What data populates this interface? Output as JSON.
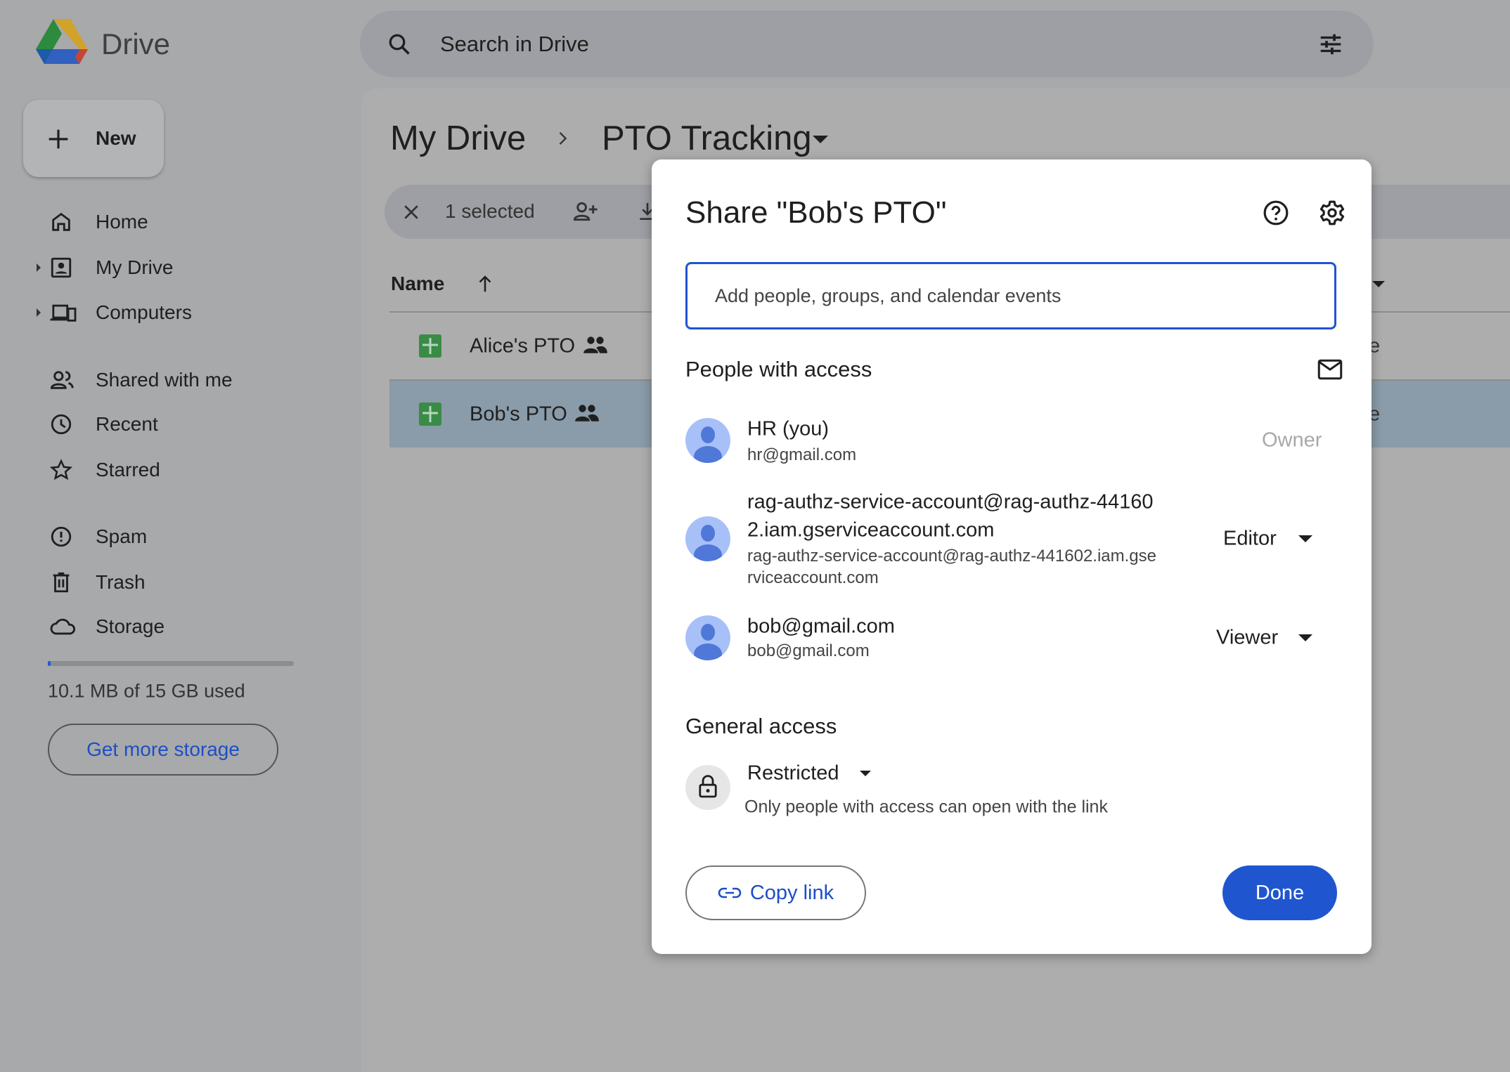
{
  "app": {
    "name": "Drive"
  },
  "search": {
    "placeholder": "Search in Drive"
  },
  "sidebar": {
    "new_label": "New",
    "items": [
      {
        "label": "Home",
        "icon": "home-icon"
      },
      {
        "label": "My Drive",
        "icon": "my-drive-icon"
      },
      {
        "label": "Computers",
        "icon": "computers-icon"
      },
      {
        "label": "Shared with me",
        "icon": "shared-icon"
      },
      {
        "label": "Recent",
        "icon": "clock-icon"
      },
      {
        "label": "Starred",
        "icon": "star-icon"
      },
      {
        "label": "Spam",
        "icon": "spam-icon"
      },
      {
        "label": "Trash",
        "icon": "trash-icon"
      },
      {
        "label": "Storage",
        "icon": "cloud-icon"
      }
    ],
    "storage_text": "10.1 MB of 15 GB used",
    "storage_fraction": 0.0007,
    "get_more_storage": "Get more storage"
  },
  "breadcrumb": {
    "root": "My Drive",
    "current": "PTO Tracking"
  },
  "selection": {
    "label": "1 selected"
  },
  "table": {
    "name_header": "Name",
    "rows": [
      {
        "name": "Alice's PTO",
        "trailing": "e",
        "selected": false
      },
      {
        "name": "Bob's PTO",
        "trailing": "e",
        "selected": true
      }
    ]
  },
  "dialog": {
    "title": "Share \"Bob's PTO\"",
    "input_placeholder": "Add people, groups, and calendar events",
    "people_heading": "People with access",
    "people": [
      {
        "name": "HR (you)",
        "email": "hr@gmail.com",
        "role": "Owner"
      },
      {
        "name_line1": "rag-authz-service-account@rag-authz-44160",
        "name_line2": "2.iam.gserviceaccount.com",
        "email_line1": "rag-authz-service-account@rag-authz-441602.iam.gse",
        "email_line2": "rviceaccount.com",
        "role": "Editor"
      },
      {
        "name": "bob@gmail.com",
        "email": "bob@gmail.com",
        "role": "Viewer"
      }
    ],
    "general_heading": "General access",
    "access_level": "Restricted",
    "access_desc": "Only people with access can open with the link",
    "copy_link": "Copy link",
    "done": "Done"
  },
  "colors": {
    "accent": "#1f56cf",
    "input_border": "#1f54d4",
    "selected_row": "#8a9ba9",
    "sheets_green": "#3a8b46"
  }
}
